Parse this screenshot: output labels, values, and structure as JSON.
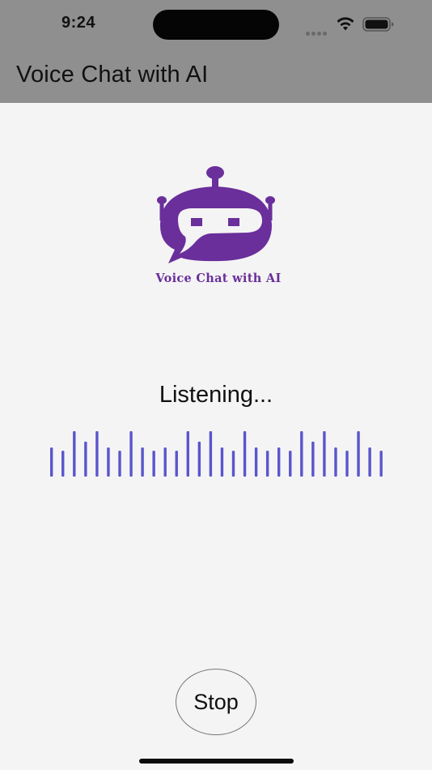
{
  "status_bar": {
    "time": "9:24",
    "icons": [
      "cellular-dots-icon",
      "wifi-icon",
      "battery-icon"
    ]
  },
  "header": {
    "title": "Voice Chat with AI"
  },
  "logo": {
    "icon": "robot-chat-icon",
    "caption": "Voice Chat with AI",
    "color": "#6a2f9b"
  },
  "main": {
    "status_label": "Listening...",
    "waveform": {
      "icon": "audio-waveform-icon",
      "color": "#5a55cc",
      "bar_levels": [
        0.64,
        0.57,
        1.0,
        0.77,
        1.0,
        0.64,
        0.57,
        1.0,
        0.64,
        0.57,
        0.64,
        0.57,
        1.0,
        0.77,
        1.0,
        0.64,
        0.57,
        1.0,
        0.64,
        0.57,
        0.64,
        0.57,
        1.0,
        0.77,
        1.0,
        0.64,
        0.57,
        1.0,
        0.64,
        0.57
      ]
    },
    "stop_label": "Stop"
  },
  "colors": {
    "header_bg": "#8f8f8f",
    "page_bg": "#f4f4f4"
  }
}
